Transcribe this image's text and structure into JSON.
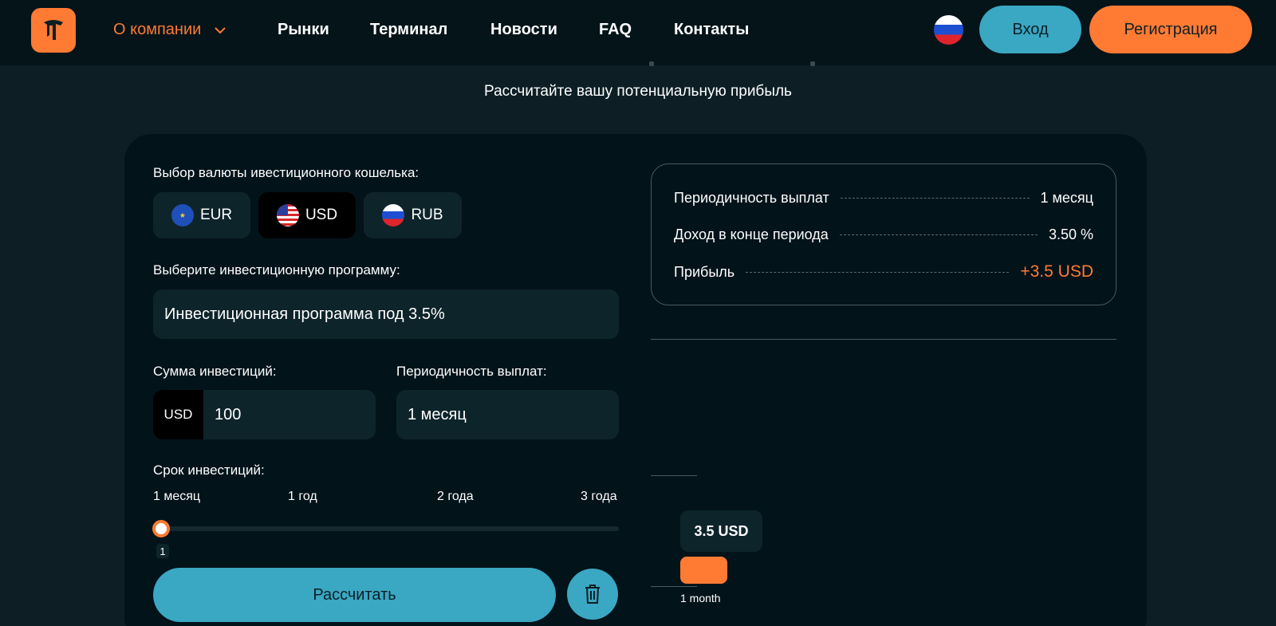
{
  "header": {
    "nav": [
      {
        "label": "О компании"
      },
      {
        "label": "Рынки"
      },
      {
        "label": "Терминал"
      },
      {
        "label": "Новости"
      },
      {
        "label": "FAQ"
      },
      {
        "label": "Контакты"
      }
    ],
    "login_label": "Вход",
    "register_label": "Регистрация"
  },
  "subtitle": "Рассчитайте вашу потенциальную прибыль",
  "calculator": {
    "currency_label": "Выбор валюты ивестиционного кошелька:",
    "currencies": [
      {
        "code": "EUR",
        "flag": "eu-flag-icon"
      },
      {
        "code": "USD",
        "flag": "us-flag-icon",
        "selected": true
      },
      {
        "code": "RUB",
        "flag": "ru-flag-icon"
      }
    ],
    "program_label": "Выберите инвестиционную программу:",
    "program_value": "Инвестиционная программа под 3.5%",
    "amount_label": "Сумма инвестиций:",
    "amount_currency": "USD",
    "amount_value": "100",
    "period_label": "Периодичность выплат:",
    "period_value": "1 месяц",
    "term_label": "Срок инвестиций:",
    "term_ticks": [
      "1 месяц",
      "1 год",
      "2 года",
      "3 года"
    ],
    "term_value": "1",
    "calculate_label": "Рассчитать"
  },
  "summary": {
    "rows": [
      {
        "key": "Периодичность выплат",
        "value": "1 месяц"
      },
      {
        "key": "Доход в конце периода",
        "value": "3.50 %"
      },
      {
        "key": "Прибыль",
        "value": "+3.5 USD"
      }
    ]
  },
  "chart_data": {
    "type": "bar",
    "categories": [
      "1 month"
    ],
    "values": [
      3.5
    ],
    "data_labels": [
      "3.5 USD"
    ],
    "ylim": [
      0,
      25
    ]
  },
  "colors": {
    "accent": "#ff7a33",
    "primary": "#3aa7c3",
    "background": "#0d1f25",
    "card": "#03131a"
  }
}
